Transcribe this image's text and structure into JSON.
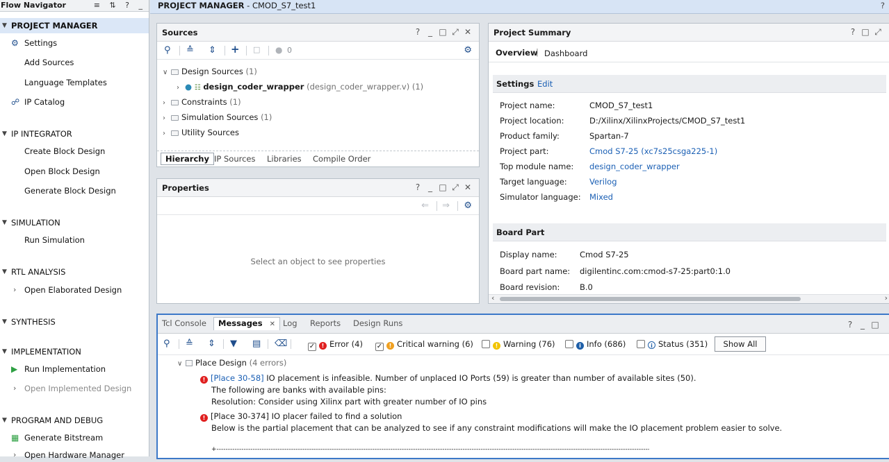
{
  "flow_navigator": {
    "title": "Flow Navigator",
    "header_tools": "≡ ⇅ ? _",
    "sections": [
      {
        "label": "PROJECT MANAGER",
        "active": true
      },
      {
        "label": "IP INTEGRATOR"
      },
      {
        "label": "SIMULATION"
      },
      {
        "label": "RTL ANALYSIS"
      },
      {
        "label": "SYNTHESIS"
      },
      {
        "label": "IMPLEMENTATION"
      },
      {
        "label": "PROGRAM AND DEBUG"
      }
    ],
    "items": {
      "settings": "Settings",
      "add_sources": "Add Sources",
      "language_templates": "Language Templates",
      "ip_catalog": "IP Catalog",
      "create_block_design": "Create Block Design",
      "open_block_design": "Open Block Design",
      "generate_block_design": "Generate Block Design",
      "run_simulation": "Run Simulation",
      "open_elaborated_design": "Open Elaborated Design",
      "run_implementation": "Run Implementation",
      "open_implemented_design": "Open Implemented Design",
      "generate_bitstream": "Generate Bitstream",
      "open_hardware_manager": "Open Hardware Manager"
    }
  },
  "titlebar": {
    "section": "PROJECT MANAGER",
    "project": " - CMOD_S7_test1",
    "help": "?"
  },
  "sources": {
    "title": "Sources",
    "controls": [
      "?",
      "_",
      "□",
      "⤢",
      "✕"
    ],
    "count": "0",
    "tree": {
      "design_sources": "Design Sources",
      "design_sources_count": "(1)",
      "top_module": "design_coder_wrapper",
      "top_module_file": "(design_coder_wrapper.v)",
      "top_module_count": "(1)",
      "constraints": "Constraints",
      "constraints_count": "(1)",
      "simulation_sources": "Simulation Sources",
      "simulation_sources_count": "(1)",
      "utility_sources": "Utility Sources"
    },
    "tabs": [
      "Hierarchy",
      "IP Sources",
      "Libraries",
      "Compile Order"
    ]
  },
  "properties": {
    "title": "Properties",
    "controls": [
      "?",
      "_",
      "□",
      "⤢",
      "✕"
    ],
    "empty_text": "Select an object to see properties"
  },
  "summary": {
    "title": "Project Summary",
    "controls": [
      "?",
      "□",
      "⤢"
    ],
    "tab_overview": "Overview",
    "tab_sep": "|",
    "tab_dashboard": "Dashboard",
    "settings_head": "Settings",
    "edit": "Edit",
    "settings": [
      {
        "key": "Project name:",
        "value": "CMOD_S7_test1",
        "link": false
      },
      {
        "key": "Project location:",
        "value": "D:/Xilinx/XilinxProjects/CMOD_S7_test1",
        "link": false
      },
      {
        "key": "Product family:",
        "value": "Spartan-7",
        "link": false
      },
      {
        "key": "Project part:",
        "value": "Cmod S7-25 (xc7s25csga225-1)",
        "link": true
      },
      {
        "key": "Top module name:",
        "value": "design_coder_wrapper",
        "link": true
      },
      {
        "key": "Target language:",
        "value": "Verilog",
        "link": true
      },
      {
        "key": "Simulator language:",
        "value": "Mixed",
        "link": true
      }
    ],
    "board_head": "Board Part",
    "board": [
      {
        "key": "Display name:",
        "value": "Cmod S7-25"
      },
      {
        "key": "Board part name:",
        "value": "digilentinc.com:cmod-s7-25:part0:1.0"
      },
      {
        "key": "Board revision:",
        "value": "B.0"
      }
    ]
  },
  "messages": {
    "tabs": [
      {
        "label": "Tcl Console"
      },
      {
        "label": "Messages",
        "active": true
      },
      {
        "label": "Log"
      },
      {
        "label": "Reports"
      },
      {
        "label": "Design Runs"
      }
    ],
    "tab_close": "✕",
    "controls": [
      "?",
      "_",
      "□"
    ],
    "filters": [
      {
        "label": "Error (4)",
        "checked": true,
        "color": "#e02020",
        "glyph": "!"
      },
      {
        "label": "Critical warning (6)",
        "checked": true,
        "color": "#f0a020",
        "glyph": "!"
      },
      {
        "label": "Warning (76)",
        "checked": false,
        "color": "#f2c400",
        "glyph": "!"
      },
      {
        "label": "Info (686)",
        "checked": false,
        "color": "#1f5fa8",
        "glyph": "i"
      },
      {
        "label": "Status (351)",
        "checked": false,
        "color": "#ffffff",
        "glyph": "i"
      }
    ],
    "show_all": "Show All",
    "group": "Place Design",
    "group_count": "(4 errors)",
    "m1_id": "[Place 30-58]",
    "m1_text": " IO placement is infeasible. Number of unplaced IO Ports (59) is greater than number of available sites (50).",
    "m1_line2": "The following are banks with available pins:",
    "m1_line3": "Resolution: Consider using Xilinx part with greater number of IO pins",
    "m2_text": "[Place 30-374] IO placer failed to find a solution",
    "m2_line2": "Below is the partial placement that can be analyzed to see if any constraint modifications will make the IO placement problem easier to solve.",
    "m2_line3": "+---------------------------------------------------------------------------------------------------------------------------------------------------------------------------------------------------------+"
  }
}
